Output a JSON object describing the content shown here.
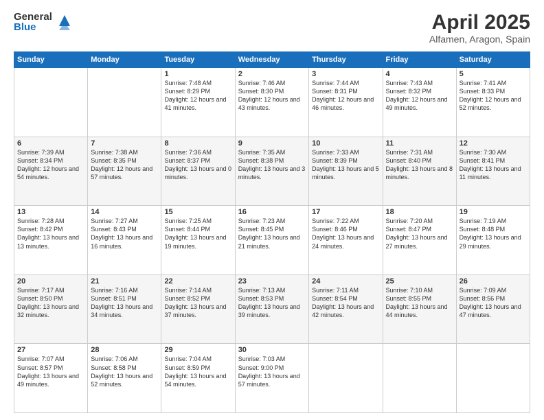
{
  "header": {
    "logo_general": "General",
    "logo_blue": "Blue",
    "title": "April 2025",
    "subtitle": "Alfamen, Aragon, Spain"
  },
  "weekdays": [
    "Sunday",
    "Monday",
    "Tuesday",
    "Wednesday",
    "Thursday",
    "Friday",
    "Saturday"
  ],
  "weeks": [
    [
      {
        "day": "",
        "info": ""
      },
      {
        "day": "",
        "info": ""
      },
      {
        "day": "1",
        "info": "Sunrise: 7:48 AM\nSunset: 8:29 PM\nDaylight: 12 hours and 41 minutes."
      },
      {
        "day": "2",
        "info": "Sunrise: 7:46 AM\nSunset: 8:30 PM\nDaylight: 12 hours and 43 minutes."
      },
      {
        "day": "3",
        "info": "Sunrise: 7:44 AM\nSunset: 8:31 PM\nDaylight: 12 hours and 46 minutes."
      },
      {
        "day": "4",
        "info": "Sunrise: 7:43 AM\nSunset: 8:32 PM\nDaylight: 12 hours and 49 minutes."
      },
      {
        "day": "5",
        "info": "Sunrise: 7:41 AM\nSunset: 8:33 PM\nDaylight: 12 hours and 52 minutes."
      }
    ],
    [
      {
        "day": "6",
        "info": "Sunrise: 7:39 AM\nSunset: 8:34 PM\nDaylight: 12 hours and 54 minutes."
      },
      {
        "day": "7",
        "info": "Sunrise: 7:38 AM\nSunset: 8:35 PM\nDaylight: 12 hours and 57 minutes."
      },
      {
        "day": "8",
        "info": "Sunrise: 7:36 AM\nSunset: 8:37 PM\nDaylight: 13 hours and 0 minutes."
      },
      {
        "day": "9",
        "info": "Sunrise: 7:35 AM\nSunset: 8:38 PM\nDaylight: 13 hours and 3 minutes."
      },
      {
        "day": "10",
        "info": "Sunrise: 7:33 AM\nSunset: 8:39 PM\nDaylight: 13 hours and 5 minutes."
      },
      {
        "day": "11",
        "info": "Sunrise: 7:31 AM\nSunset: 8:40 PM\nDaylight: 13 hours and 8 minutes."
      },
      {
        "day": "12",
        "info": "Sunrise: 7:30 AM\nSunset: 8:41 PM\nDaylight: 13 hours and 11 minutes."
      }
    ],
    [
      {
        "day": "13",
        "info": "Sunrise: 7:28 AM\nSunset: 8:42 PM\nDaylight: 13 hours and 13 minutes."
      },
      {
        "day": "14",
        "info": "Sunrise: 7:27 AM\nSunset: 8:43 PM\nDaylight: 13 hours and 16 minutes."
      },
      {
        "day": "15",
        "info": "Sunrise: 7:25 AM\nSunset: 8:44 PM\nDaylight: 13 hours and 19 minutes."
      },
      {
        "day": "16",
        "info": "Sunrise: 7:23 AM\nSunset: 8:45 PM\nDaylight: 13 hours and 21 minutes."
      },
      {
        "day": "17",
        "info": "Sunrise: 7:22 AM\nSunset: 8:46 PM\nDaylight: 13 hours and 24 minutes."
      },
      {
        "day": "18",
        "info": "Sunrise: 7:20 AM\nSunset: 8:47 PM\nDaylight: 13 hours and 27 minutes."
      },
      {
        "day": "19",
        "info": "Sunrise: 7:19 AM\nSunset: 8:48 PM\nDaylight: 13 hours and 29 minutes."
      }
    ],
    [
      {
        "day": "20",
        "info": "Sunrise: 7:17 AM\nSunset: 8:50 PM\nDaylight: 13 hours and 32 minutes."
      },
      {
        "day": "21",
        "info": "Sunrise: 7:16 AM\nSunset: 8:51 PM\nDaylight: 13 hours and 34 minutes."
      },
      {
        "day": "22",
        "info": "Sunrise: 7:14 AM\nSunset: 8:52 PM\nDaylight: 13 hours and 37 minutes."
      },
      {
        "day": "23",
        "info": "Sunrise: 7:13 AM\nSunset: 8:53 PM\nDaylight: 13 hours and 39 minutes."
      },
      {
        "day": "24",
        "info": "Sunrise: 7:11 AM\nSunset: 8:54 PM\nDaylight: 13 hours and 42 minutes."
      },
      {
        "day": "25",
        "info": "Sunrise: 7:10 AM\nSunset: 8:55 PM\nDaylight: 13 hours and 44 minutes."
      },
      {
        "day": "26",
        "info": "Sunrise: 7:09 AM\nSunset: 8:56 PM\nDaylight: 13 hours and 47 minutes."
      }
    ],
    [
      {
        "day": "27",
        "info": "Sunrise: 7:07 AM\nSunset: 8:57 PM\nDaylight: 13 hours and 49 minutes."
      },
      {
        "day": "28",
        "info": "Sunrise: 7:06 AM\nSunset: 8:58 PM\nDaylight: 13 hours and 52 minutes."
      },
      {
        "day": "29",
        "info": "Sunrise: 7:04 AM\nSunset: 8:59 PM\nDaylight: 13 hours and 54 minutes."
      },
      {
        "day": "30",
        "info": "Sunrise: 7:03 AM\nSunset: 9:00 PM\nDaylight: 13 hours and 57 minutes."
      },
      {
        "day": "",
        "info": ""
      },
      {
        "day": "",
        "info": ""
      },
      {
        "day": "",
        "info": ""
      }
    ]
  ]
}
